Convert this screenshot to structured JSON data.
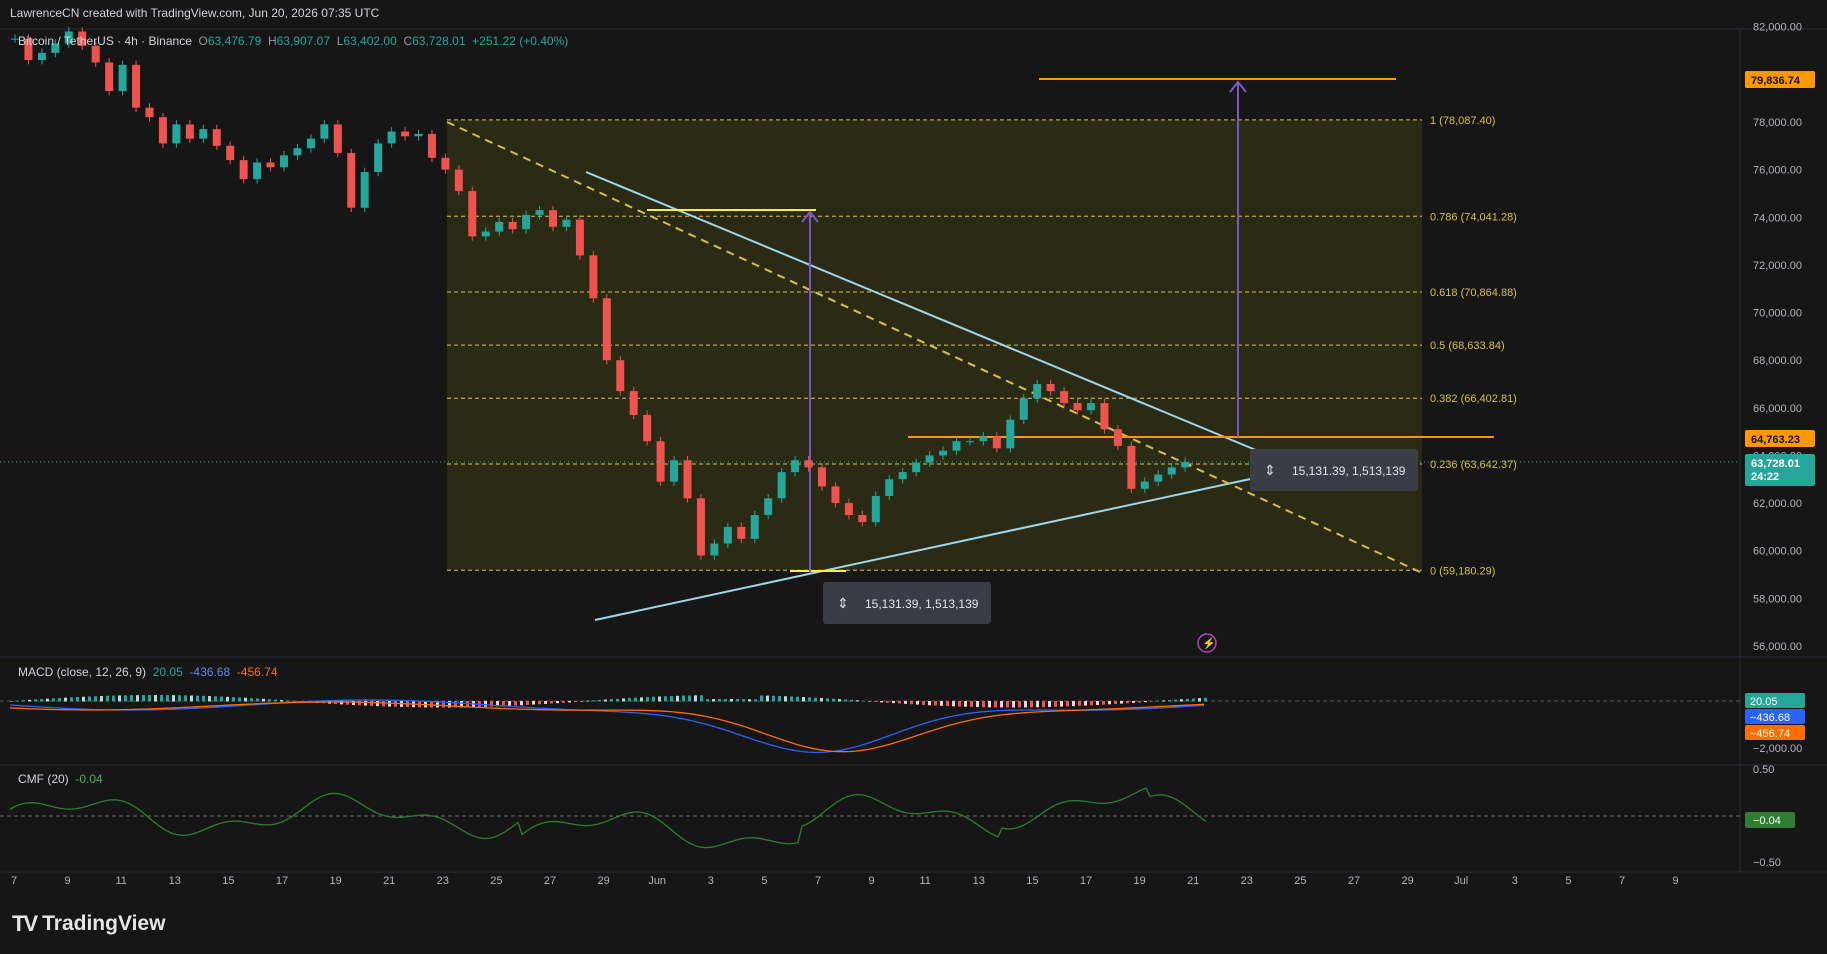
{
  "header": {
    "credit": "LawrenceCN created with TradingView.com, Jun 20, 2026 07:35 UTC"
  },
  "symbol": {
    "name": "Bitcoin / TetherUS · 4h · Binance",
    "open_label": "O",
    "open": "63,476.79",
    "high_label": "H",
    "high": "63,907.07",
    "low_label": "L",
    "low": "63,402.00",
    "close_label": "C",
    "close": "63,728.01",
    "change": "+251.22 (+0.40%)"
  },
  "branding": {
    "logo": "TV",
    "name": "TradingView"
  },
  "colors": {
    "up": "#26a69a",
    "down": "#ef5350",
    "fib": "#d7c24a",
    "trend": "#9fd6e8",
    "orange": "#ff9800",
    "yellow": "#ffeb3b",
    "purple": "#7e57c2",
    "macd": "#2962ff",
    "signal": "#ff6d00",
    "cmf": "#2e7d32"
  },
  "chart_data": [
    {
      "type": "candlestick",
      "title": "Bitcoin / TetherUS · 4h · Binance",
      "y_axis_ticks": [
        "56,000.00",
        "58,000.00",
        "60,000.00",
        "62,000.00",
        "64,000.00",
        "66,000.00",
        "68,000.00",
        "70,000.00",
        "72,000.00",
        "74,000.00",
        "76,000.00",
        "78,000.00",
        "82,000.00"
      ],
      "ylim": [
        55500,
        82000
      ],
      "x_axis_ticks": [
        "7",
        "9",
        "11",
        "13",
        "15",
        "17",
        "19",
        "21",
        "23",
        "25",
        "27",
        "29",
        "Jun",
        "3",
        "5",
        "7",
        "9",
        "11",
        "13",
        "15",
        "17",
        "19",
        "21",
        "23",
        "25",
        "27",
        "29",
        "Jul",
        "3",
        "5",
        "7",
        "9"
      ],
      "price_path": [
        [
          0,
          81500
        ],
        [
          1,
          80600
        ],
        [
          2,
          80900
        ],
        [
          3,
          81300
        ],
        [
          4,
          81800
        ],
        [
          5,
          81200
        ],
        [
          6,
          80500
        ],
        [
          7,
          79300
        ],
        [
          8,
          80400
        ],
        [
          9,
          78600
        ],
        [
          10,
          78200
        ],
        [
          11,
          77100
        ],
        [
          12,
          77900
        ],
        [
          13,
          77300
        ],
        [
          14,
          77700
        ],
        [
          15,
          77000
        ],
        [
          16,
          76400
        ],
        [
          17,
          75600
        ],
        [
          18,
          76300
        ],
        [
          19,
          76100
        ],
        [
          20,
          76600
        ],
        [
          21,
          76900
        ],
        [
          22,
          77300
        ],
        [
          23,
          77900
        ],
        [
          24,
          76700
        ],
        [
          25,
          74400
        ],
        [
          26,
          75900
        ],
        [
          27,
          77100
        ],
        [
          28,
          77600
        ],
        [
          29,
          77400
        ],
        [
          30,
          77500
        ],
        [
          31,
          76500
        ],
        [
          32,
          76000
        ],
        [
          33,
          75100
        ],
        [
          34,
          73200
        ],
        [
          35,
          73400
        ],
        [
          36,
          73800
        ],
        [
          37,
          73500
        ],
        [
          38,
          74100
        ],
        [
          39,
          74300
        ],
        [
          40,
          73600
        ],
        [
          41,
          73900
        ],
        [
          42,
          72400
        ],
        [
          43,
          70600
        ],
        [
          44,
          68000
        ],
        [
          45,
          66700
        ],
        [
          46,
          65700
        ],
        [
          47,
          64600
        ],
        [
          48,
          62900
        ],
        [
          49,
          63800
        ],
        [
          50,
          62200
        ],
        [
          51,
          59800
        ],
        [
          52,
          60300
        ],
        [
          53,
          61000
        ],
        [
          54,
          60500
        ],
        [
          55,
          61500
        ],
        [
          56,
          62200
        ],
        [
          57,
          63300
        ],
        [
          58,
          63800
        ],
        [
          59,
          63500
        ],
        [
          60,
          62700
        ],
        [
          61,
          62000
        ],
        [
          62,
          61500
        ],
        [
          63,
          61200
        ],
        [
          64,
          62300
        ],
        [
          65,
          63000
        ],
        [
          66,
          63300
        ],
        [
          67,
          63700
        ],
        [
          68,
          64000
        ],
        [
          69,
          64200
        ],
        [
          70,
          64600
        ],
        [
          71,
          64600
        ],
        [
          72,
          64800
        ],
        [
          73,
          64300
        ],
        [
          74,
          65500
        ],
        [
          75,
          66400
        ],
        [
          76,
          67000
        ],
        [
          77,
          66700
        ],
        [
          78,
          66200
        ],
        [
          79,
          65900
        ],
        [
          80,
          66200
        ],
        [
          81,
          65100
        ],
        [
          82,
          64400
        ],
        [
          83,
          62600
        ],
        [
          84,
          62900
        ],
        [
          85,
          63200
        ],
        [
          86,
          63500
        ],
        [
          87,
          63728
        ]
      ],
      "last_price": "63,728.01",
      "countdown": "24:22",
      "fib_levels": [
        {
          "ratio": 1,
          "value": 78087.4,
          "label": "1 (78,087.40)"
        },
        {
          "ratio": 0.786,
          "value": 74041.28,
          "label": "0.786 (74,041.28)"
        },
        {
          "ratio": 0.618,
          "value": 70864.88,
          "label": "0.618 (70,864.88)"
        },
        {
          "ratio": 0.5,
          "value": 68633.84,
          "label": "0.5 (68,633.84)"
        },
        {
          "ratio": 0.382,
          "value": 66402.81,
          "label": "0.382 (66,402.81)"
        },
        {
          "ratio": 0.236,
          "value": 63642.37,
          "label": "0.236 (63,642.37)"
        },
        {
          "ratio": 0,
          "value": 59180.29,
          "label": "0 (59,180.29)"
        }
      ],
      "price_labels": {
        "target": "79,836.74",
        "resistance": "64,763.23"
      },
      "measure_labels": [
        "15,131.39, 1,513,139",
        "15,131.39, 1,513,139"
      ]
    },
    {
      "type": "line",
      "title": "MACD (close, 12, 26, 9)",
      "series": [
        {
          "name": "Histogram",
          "value": "20.05"
        },
        {
          "name": "MACD",
          "value": "-436.68"
        },
        {
          "name": "Signal",
          "value": "-456.74"
        }
      ],
      "y_axis_ticks": [
        "−2,000.00"
      ],
      "labels": [
        "20.05",
        "−436.68",
        "−456.74"
      ]
    },
    {
      "type": "line",
      "title": "CMF (20)",
      "series": [
        {
          "name": "CMF",
          "value": "-0.04"
        }
      ],
      "y_axis_ticks": [
        "0.50",
        "−0.50"
      ],
      "labels": [
        "−0.04"
      ]
    }
  ]
}
